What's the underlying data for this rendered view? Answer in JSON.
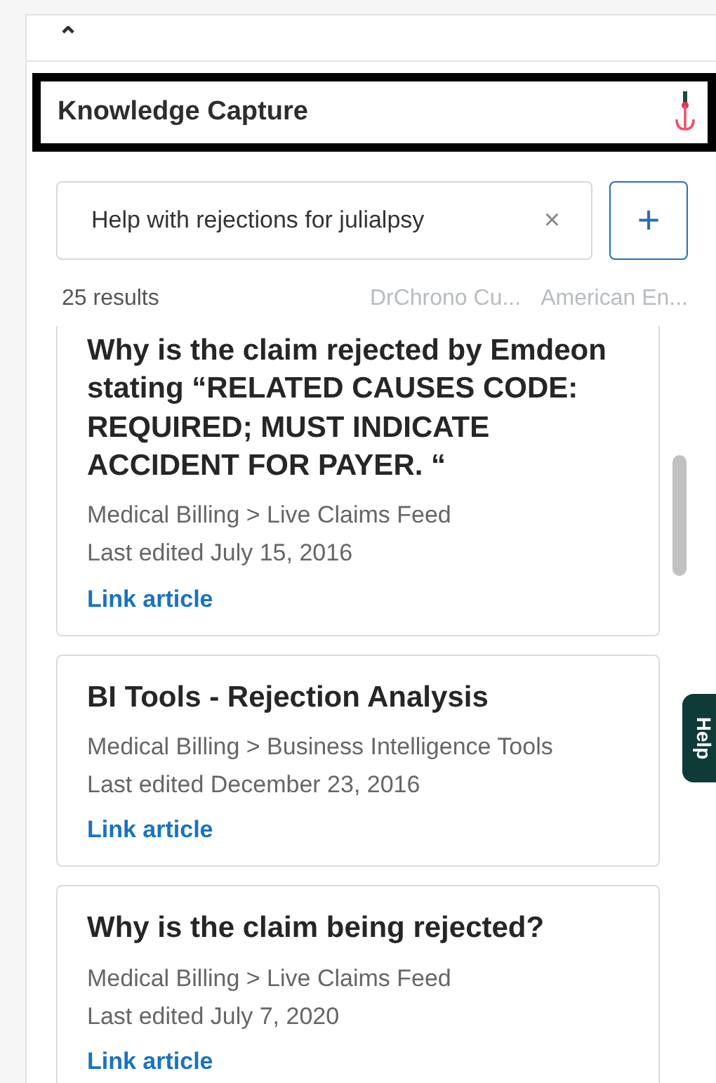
{
  "panel": {
    "collapse_icon": "⌃",
    "title": "Knowledge Capture"
  },
  "search": {
    "value": "Help with rejections for julialpsy",
    "clear": "×",
    "add": "+"
  },
  "results": {
    "count": "25 results",
    "filters": [
      "DrChrono Cu...",
      "American En..."
    ]
  },
  "articles": [
    {
      "title": "Why is the claim rejected by Emdeon stating “RELATED CAUSES CODE: REQUIRED; MUST INDICATE ACCIDENT FOR PAYER. “",
      "path": [
        "Medical Billing",
        "Live Claims Feed"
      ],
      "separator": ">",
      "edited": "Last edited July 15, 2016",
      "link": "Link article"
    },
    {
      "title": "BI Tools - Rejection Analysis",
      "path": [
        "Medical Billing",
        "Business Intelligence Tools"
      ],
      "separator": ">",
      "edited": "Last edited December 23, 2016",
      "link": "Link article"
    },
    {
      "title": "Why is the claim being rejected?",
      "path": [
        "Medical Billing",
        "Live Claims Feed"
      ],
      "separator": ">",
      "edited": "Last edited July 7, 2020",
      "link": "Link article"
    }
  ],
  "help_tab": "Help"
}
